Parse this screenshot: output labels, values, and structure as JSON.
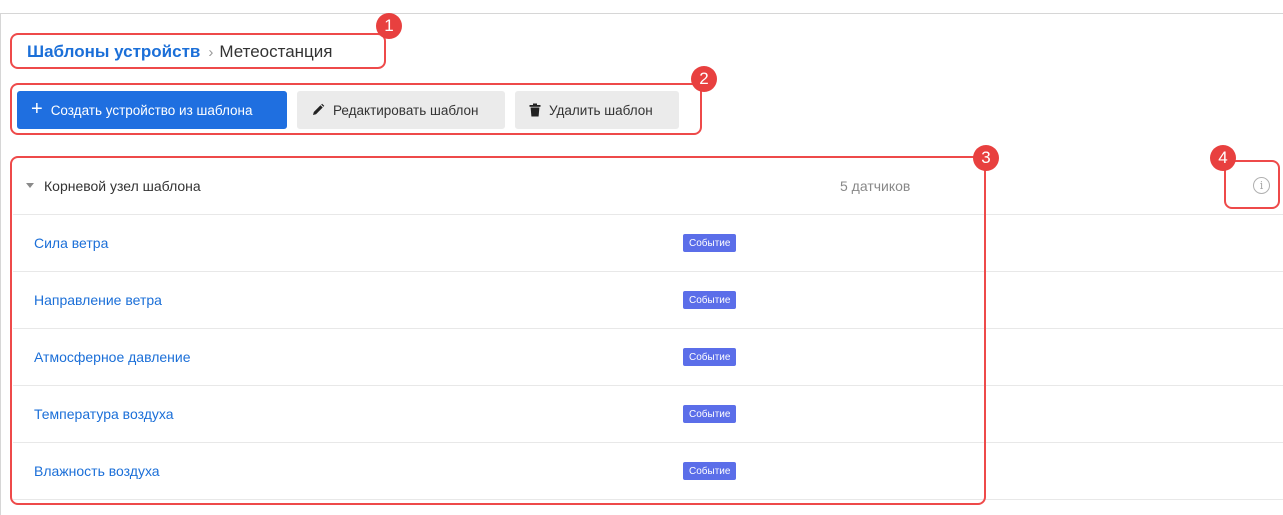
{
  "breadcrumb": {
    "parent": "Шаблоны устройств",
    "separator": "›",
    "current": "Метеостанция"
  },
  "toolbar": {
    "create_label": "Создать устройство из шаблона",
    "edit_label": "Редактировать шаблон",
    "delete_label": "Удалить шаблон"
  },
  "tree": {
    "root_label": "Корневой узел шаблона",
    "sensor_count": "5 датчиков",
    "sensors": [
      {
        "name": "Сила ветра",
        "badge": "Событие"
      },
      {
        "name": "Направление ветра",
        "badge": "Событие"
      },
      {
        "name": "Атмосферное давление",
        "badge": "Событие"
      },
      {
        "name": "Температура воздуха",
        "badge": "Событие"
      },
      {
        "name": "Влажность воздуха",
        "badge": "Событие"
      }
    ]
  },
  "annotations": [
    "1",
    "2",
    "3",
    "4"
  ],
  "icons": {
    "create": "plus-icon",
    "edit": "pencil-icon",
    "delete": "trash-icon",
    "root": "caret-down-icon",
    "info": "info-icon"
  },
  "colors": {
    "primary": "#1f6fe0",
    "link": "#1b6fd8",
    "badge": "#5b6ee9",
    "annotation": "#e8403f"
  }
}
